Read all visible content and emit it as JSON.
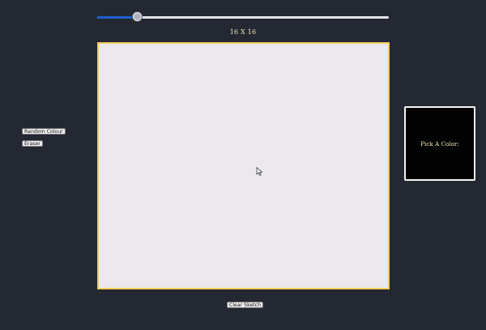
{
  "grid_size": {
    "label": "16 X 16",
    "slider_value_fraction": 0.14
  },
  "controls": {
    "random_colour_label": "Random Colour",
    "eraser_label": "Eraser",
    "clear_sketch_label": "Clear Sketch"
  },
  "color_picker": {
    "label": "Pick A Color:",
    "current_color": "#030303"
  },
  "colors": {
    "background": "#232833",
    "canvas": "#ebe9ed",
    "canvas_border": "#f3c95a",
    "accent": "#1f5fd1",
    "label_text": "#f3e8b6"
  }
}
